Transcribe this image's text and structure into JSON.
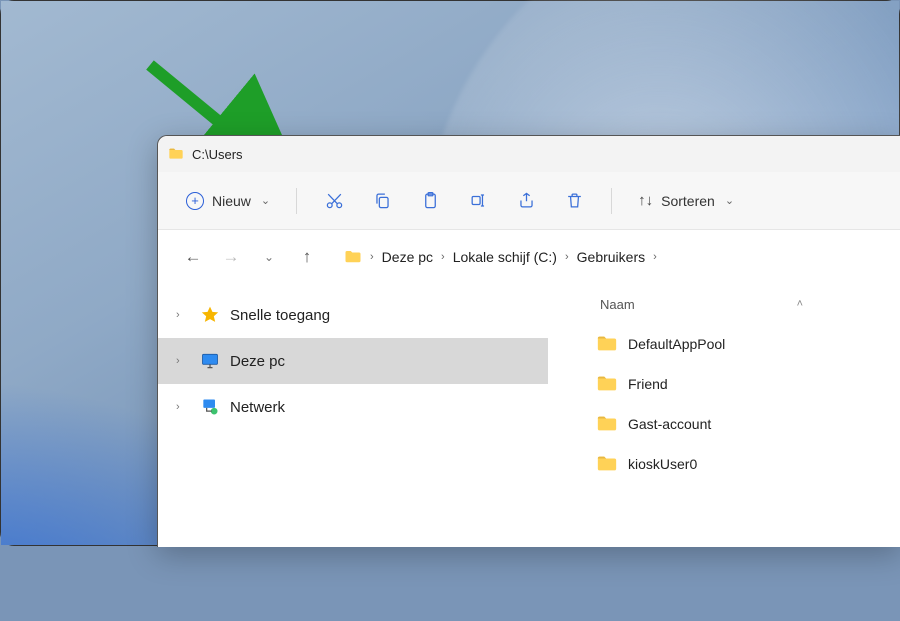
{
  "window": {
    "title": "C:\\Users"
  },
  "toolbar": {
    "new_label": "Nieuw",
    "sort_label": "Sorteren"
  },
  "breadcrumb": {
    "items": [
      "Deze pc",
      "Lokale schijf (C:)",
      "Gebruikers"
    ]
  },
  "sidebar": {
    "items": [
      {
        "label": "Snelle toegang",
        "icon": "star",
        "selected": false
      },
      {
        "label": "Deze pc",
        "icon": "monitor",
        "selected": true
      },
      {
        "label": "Netwerk",
        "icon": "network",
        "selected": false
      }
    ]
  },
  "columns": {
    "name": "Naam"
  },
  "files": [
    {
      "name": "DefaultAppPool"
    },
    {
      "name": "Friend"
    },
    {
      "name": "Gast-account"
    },
    {
      "name": "kioskUser0"
    }
  ]
}
